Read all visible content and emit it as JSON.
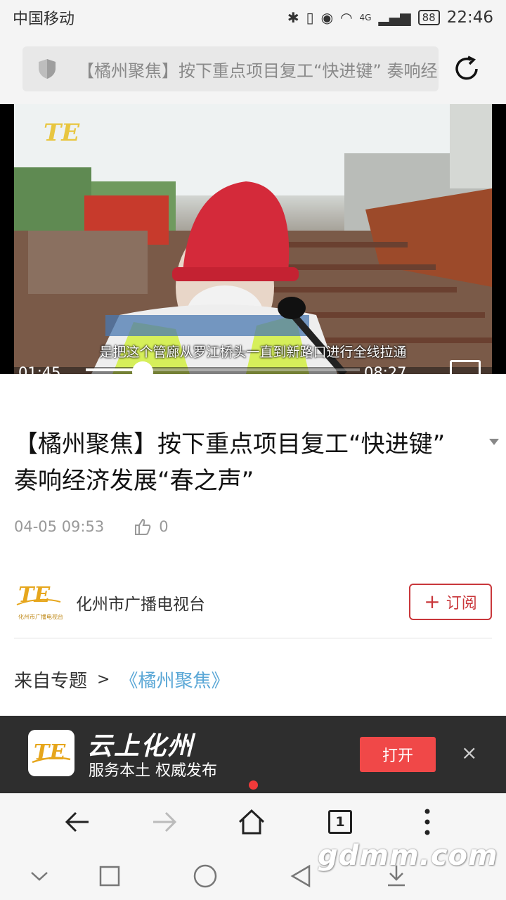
{
  "status_bar": {
    "carrier": "中国移动",
    "network": "4G",
    "battery": "88",
    "time": "22:46"
  },
  "url_bar": {
    "url_text": "【橘州聚焦】按下重点项目复工“快进键” 奏响经济发展“春之声”"
  },
  "video": {
    "subtitle": "是把这个管廊从罗江桥头一直到新路口进行全线拉通",
    "current_time": "01:45",
    "duration": "08:27",
    "progress": 0.207
  },
  "article": {
    "title": "【橘州聚焦】按下重点项目复工“快进键” 奏响经济发展“春之声”",
    "date": "04-05 09:53",
    "likes": "0"
  },
  "source": {
    "name": "化州市广播电视台",
    "logo_caption": "化州市广播电视台",
    "subscribe_label": "订阅"
  },
  "topic": {
    "prefix": "来自专题",
    "arrow": ">",
    "link": "《橘州聚焦》"
  },
  "app_banner": {
    "name": "云上化州",
    "slogan": "服务本土 权威发布",
    "open_label": "打开",
    "close_label": "×"
  },
  "toolbar": {
    "tab_count": "1"
  },
  "watermark": "gdmm.com",
  "colors": {
    "accent_red": "#c9373b",
    "open_button": "#f04848",
    "topic_link": "#5aa7d6",
    "banner_bg": "#2e2e2e"
  },
  "icons": [
    "shield-icon",
    "reload-icon",
    "like-icon",
    "plus-icon",
    "back-icon",
    "forward-icon",
    "home-icon",
    "more-icon",
    "collapse-icon",
    "recents-icon",
    "home-nav-icon",
    "back-nav-icon",
    "download-icon"
  ]
}
